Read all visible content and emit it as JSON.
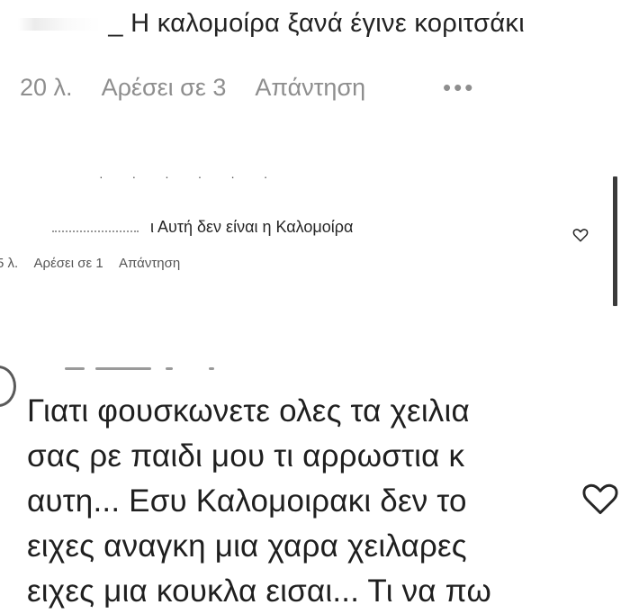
{
  "comment1": {
    "text_prefix": "_",
    "text": "Η καλομοίρα ξανά έγινε κοριτσάκι",
    "time": "20 λ.",
    "likes": "Αρέσει σε 3",
    "reply": "Απάντηση",
    "more": "•••"
  },
  "comment2": {
    "text": "Αυτή δεν είναι η Καλομοίρα",
    "text_prefix": "ι",
    "time": "5 λ.",
    "likes": "Αρέσει σε 1",
    "reply": "Απάντηση"
  },
  "comment3": {
    "lines": [
      "Γιατι φουσκωνετε ολες τα χειλια",
      "σας ρε παιδι μου τι αρρωστια κ",
      "αυτη... Εσυ Καλομοιρακι δεν το",
      "ειχες αναγκη μια χαρα χειλαρες",
      "ειχες μια κουκλα εισαι... Τι να πω"
    ]
  },
  "icons": {
    "like": "heart-outline-icon",
    "more": "more-horizontal-icon"
  },
  "colors": {
    "text": "#262626",
    "meta": "#8e8e8e",
    "scrollbar": "#3b3b3b"
  }
}
